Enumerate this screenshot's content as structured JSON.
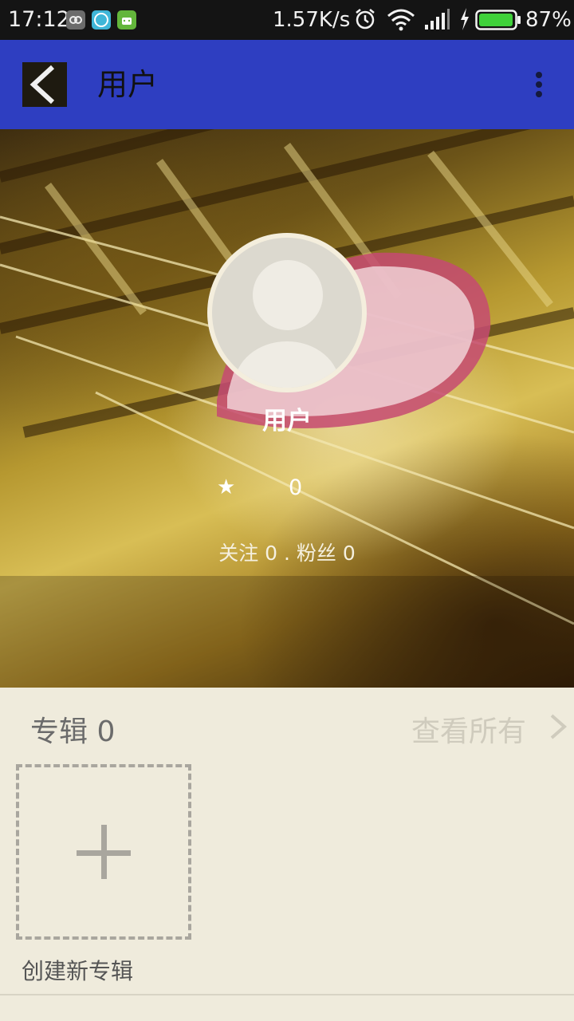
{
  "status_bar": {
    "time": "17:12",
    "net_speed": "1.57K/s",
    "battery_percent": "87%",
    "battery_level": 0.87
  },
  "app_bar": {
    "title": "用户",
    "back_icon": "chevron-left-icon",
    "menu_icon": "more-vert-icon",
    "color": "#2e3ec1"
  },
  "profile": {
    "name": "用户",
    "star_icon": "★",
    "score": "0",
    "follow_summary": "关注 0 . 粉丝 0"
  },
  "albums": {
    "title": "专辑 0",
    "view_all": "查看所有",
    "create_label": "创建新专辑"
  }
}
